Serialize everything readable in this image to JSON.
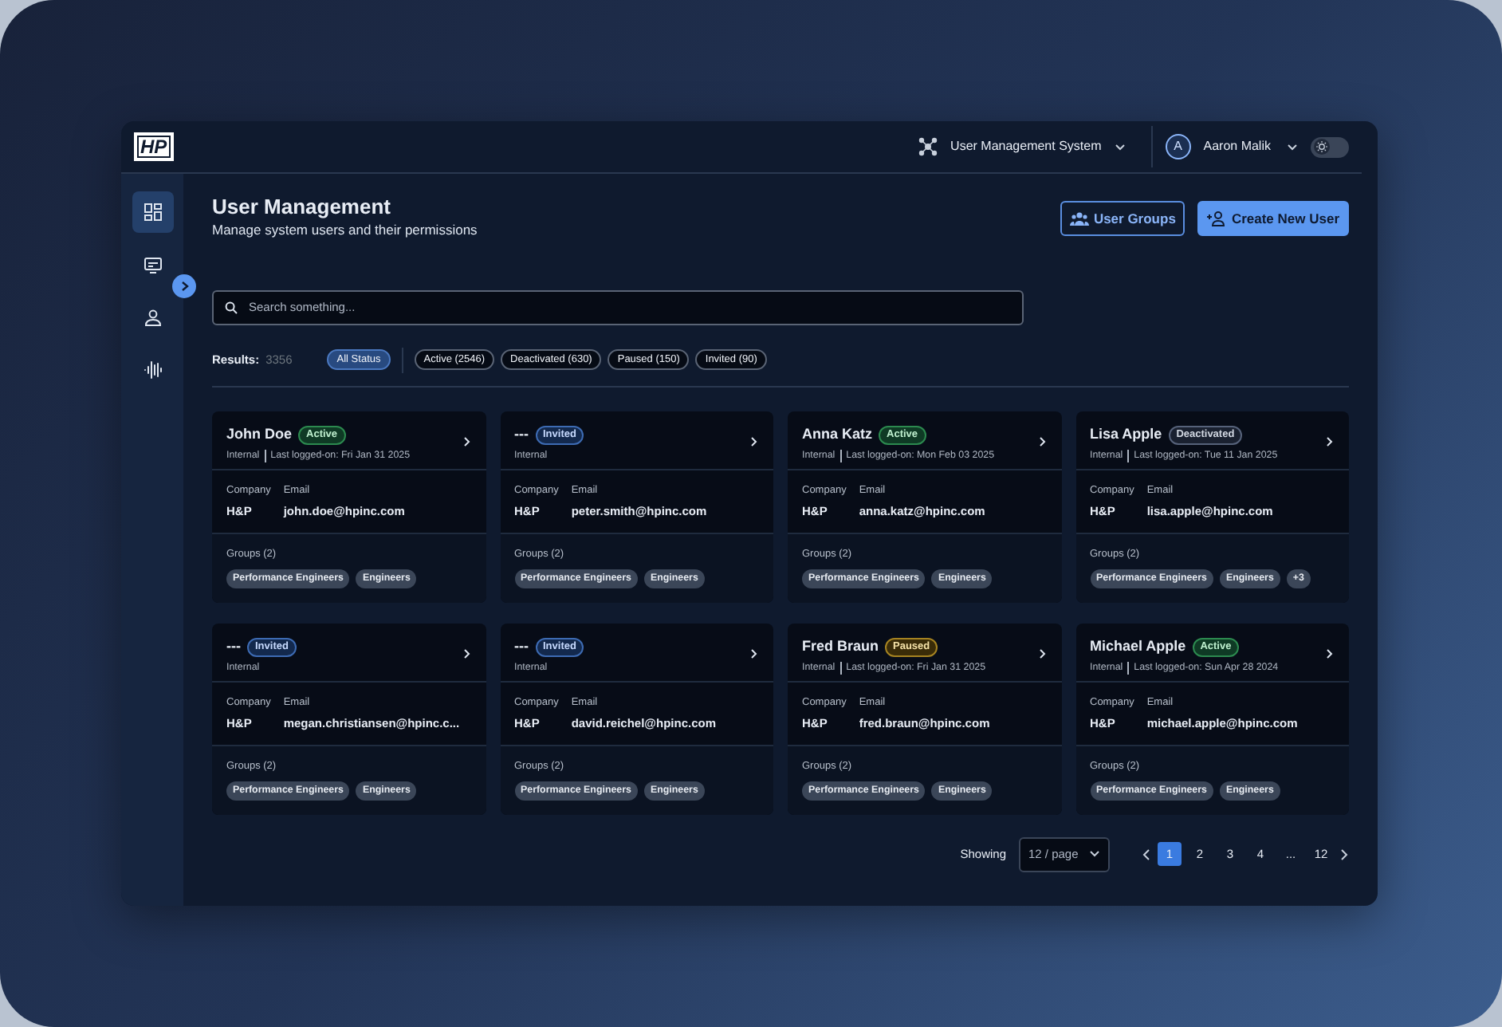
{
  "topbar": {
    "logo": "HP",
    "system": "User Management System",
    "user": {
      "initial": "A",
      "name": "Aaron Malik"
    },
    "theme_toggle": {
      "on": false
    }
  },
  "sidebar": {
    "items": [
      {
        "selected": true
      },
      {
        "selected": false
      },
      {
        "selected": false
      },
      {
        "selected": false
      }
    ]
  },
  "header": {
    "title": "User Management",
    "subtitle": "Manage system users and their permissions",
    "buttons": [
      {
        "label": "User Groups",
        "kind": "outline"
      },
      {
        "label": "Create New User",
        "kind": "primary"
      }
    ]
  },
  "search": {
    "placeholder": "Search something..."
  },
  "results": {
    "label": "Results:",
    "count": "3356"
  },
  "filters": [
    {
      "label": "All Status",
      "selected": true
    },
    {
      "label": "Active (2546)",
      "selected": false
    },
    {
      "label": "Deactivated (630)",
      "selected": false
    },
    {
      "label": "Paused (150)",
      "selected": false
    },
    {
      "label": "Invited (90)",
      "selected": false
    }
  ],
  "users": [
    {
      "name": "John Doe",
      "status": {
        "label": "Active",
        "kind": "active"
      },
      "type": "Internal",
      "last_login": "Last logged-on: Fri Jan 31 2025",
      "company_label": "Company",
      "company": "H&P",
      "email_label": "Email",
      "email": "john.doe@hpinc.com",
      "groups_label": "Groups (2)",
      "groups": [
        "Performance Engineers",
        "Engineers"
      ]
    },
    {
      "name": "---",
      "status": {
        "label": "Invited",
        "kind": "invited"
      },
      "type": "Internal",
      "company_label": "Company",
      "company": "H&P",
      "email_label": "Email",
      "email": "peter.smith@hpinc.com",
      "groups_label": "Groups (2)",
      "groups": [
        "Performance Engineers",
        "Engineers"
      ]
    },
    {
      "name": "Anna Katz",
      "status": {
        "label": "Active",
        "kind": "active"
      },
      "type": "Internal",
      "last_login": "Last logged-on: Mon Feb 03 2025",
      "company_label": "Company",
      "company": "H&P",
      "email_label": "Email",
      "email": "anna.katz@hpinc.com",
      "groups_label": "Groups (2)",
      "groups": [
        "Performance Engineers",
        "Engineers"
      ]
    },
    {
      "name": "Lisa Apple",
      "status": {
        "label": "Deactivated",
        "kind": "deactivated"
      },
      "type": "Internal",
      "last_login": "Last logged-on: Tue 11 Jan 2025",
      "company_label": "Company",
      "company": "H&P",
      "email_label": "Email",
      "email": "lisa.apple@hpinc.com",
      "groups_label": "Groups (2)",
      "groups": [
        "Performance Engineers",
        "Engineers"
      ],
      "more_groups": "+3"
    },
    {
      "name": "---",
      "status": {
        "label": "Invited",
        "kind": "invited"
      },
      "type": "Internal",
      "company_label": "Company",
      "company": "H&P",
      "email_label": "Email",
      "email": "megan.christiansen@hpinc.c...",
      "groups_label": "Groups (2)",
      "groups": [
        "Performance Engineers",
        "Engineers"
      ]
    },
    {
      "name": "---",
      "status": {
        "label": "Invited",
        "kind": "invited"
      },
      "type": "Internal",
      "company_label": "Company",
      "company": "H&P",
      "email_label": "Email",
      "email": "david.reichel@hpinc.com",
      "groups_label": "Groups (2)",
      "groups": [
        "Performance Engineers",
        "Engineers"
      ]
    },
    {
      "name": "Fred Braun",
      "status": {
        "label": "Paused",
        "kind": "paused"
      },
      "type": "Internal",
      "last_login": "Last logged-on: Fri Jan 31 2025",
      "company_label": "Company",
      "company": "H&P",
      "email_label": "Email",
      "email": "fred.braun@hpinc.com",
      "groups_label": "Groups (2)",
      "groups": [
        "Performance Engineers",
        "Engineers"
      ]
    },
    {
      "name": "Michael Apple",
      "status": {
        "label": "Active",
        "kind": "active"
      },
      "type": "Internal",
      "last_login": "Last logged-on: Sun Apr 28 2024",
      "company_label": "Company",
      "company": "H&P",
      "email_label": "Email",
      "email": "michael.apple@hpinc.com",
      "groups_label": "Groups (2)",
      "groups": [
        "Performance Engineers",
        "Engineers"
      ]
    }
  ],
  "pagination": {
    "label": "Showing",
    "page_size": "12 / page",
    "pages": [
      {
        "label": "1",
        "selected": true
      },
      {
        "label": "2",
        "selected": false
      },
      {
        "label": "3",
        "selected": false
      },
      {
        "label": "4",
        "selected": false
      },
      {
        "label": "12",
        "selected": false
      }
    ],
    "gap": "..."
  }
}
